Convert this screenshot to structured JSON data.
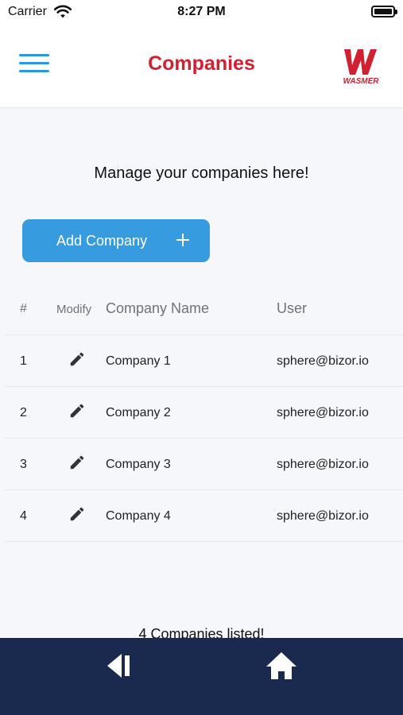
{
  "status_bar": {
    "carrier": "Carrier",
    "time": "8:27 PM"
  },
  "header": {
    "title": "Companies",
    "logo_text": "WASMER",
    "accent_color": "#d12032",
    "menu_color": "#2d96e0"
  },
  "main": {
    "subtitle": "Manage your companies here!",
    "add_button": {
      "label": "Add Company",
      "color": "#379be0"
    }
  },
  "table": {
    "headers": {
      "num": "#",
      "modify": "Modify",
      "name": "Company Name",
      "user": "User"
    },
    "rows": [
      {
        "num": "1",
        "name": "Company 1",
        "user": "sphere@bizor.io"
      },
      {
        "num": "2",
        "name": "Company 2",
        "user": "sphere@bizor.io"
      },
      {
        "num": "3",
        "name": "Company 3",
        "user": "sphere@bizor.io"
      },
      {
        "num": "4",
        "name": "Company 4",
        "user": "sphere@bizor.io"
      }
    ]
  },
  "footer": {
    "count_text": "4 Companies listed!"
  },
  "bottom_nav": {
    "bar_color": "#1a2a4f",
    "icons": [
      "back-icon",
      "home-icon"
    ]
  }
}
